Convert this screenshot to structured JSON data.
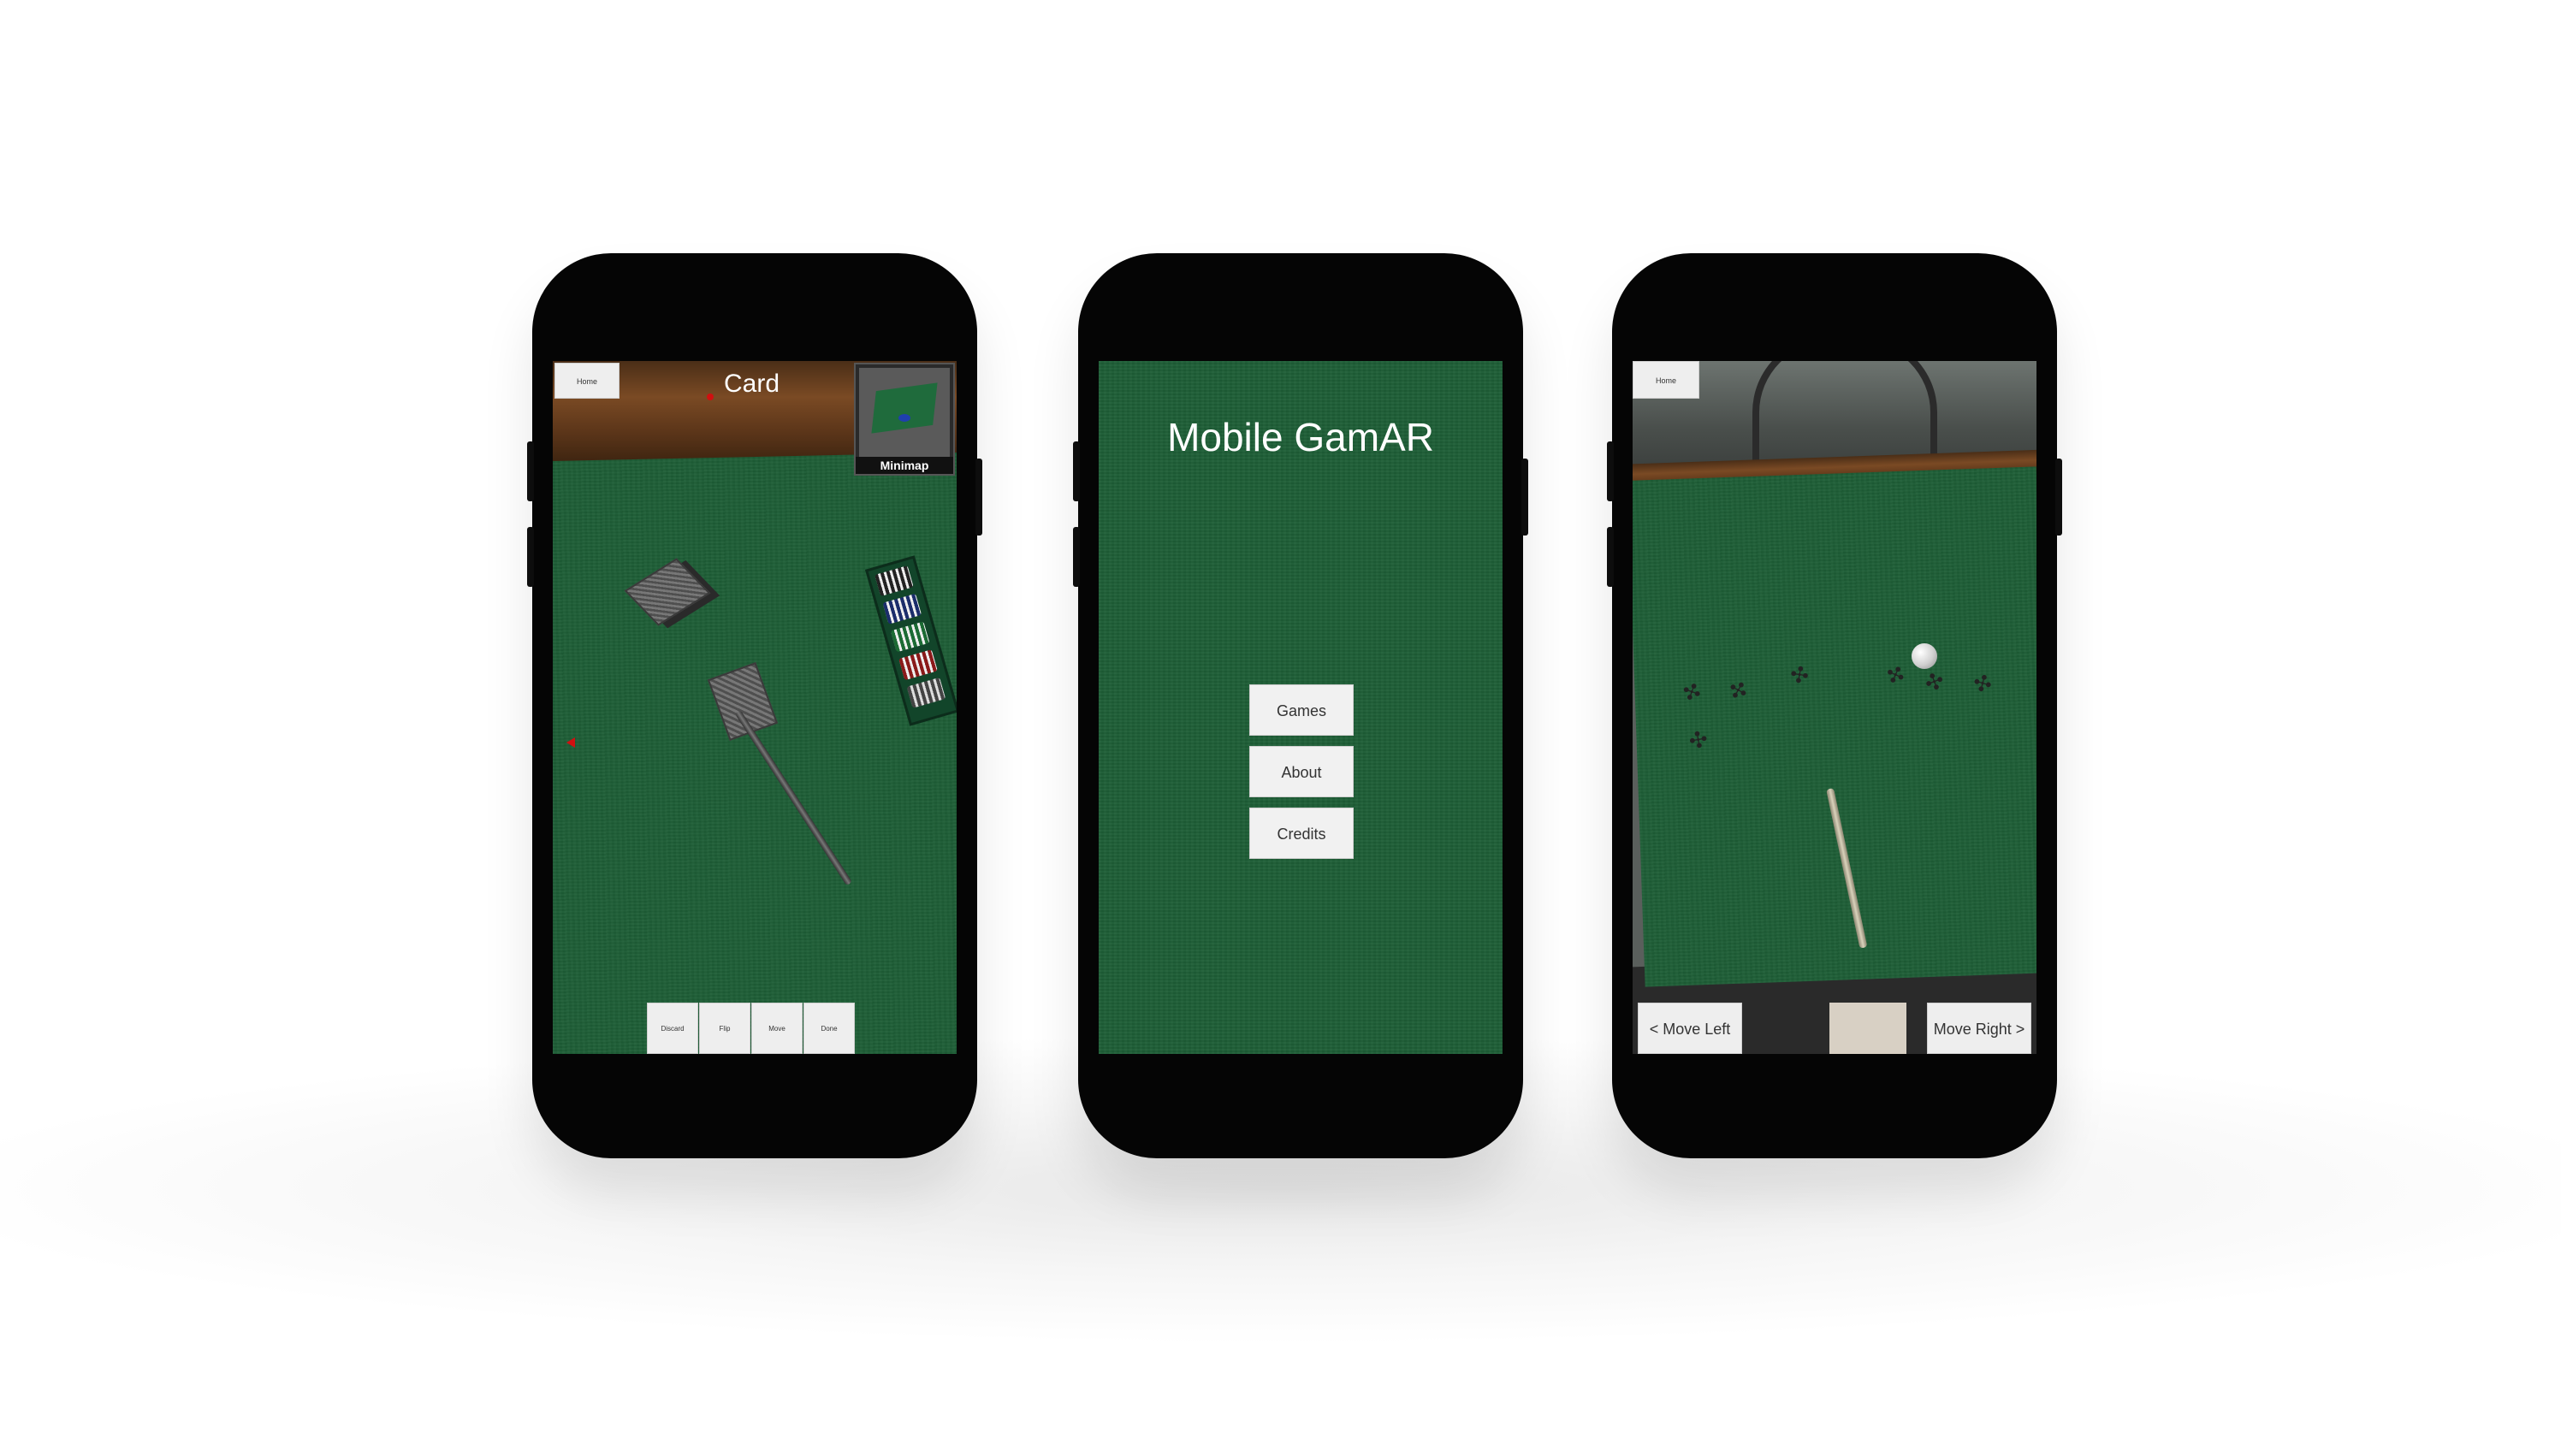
{
  "card_game_screen": {
    "home_label": "Home",
    "title": "Card",
    "minimap_label": "Minimap",
    "actions": [
      "Discard",
      "Flip",
      "Move",
      "Done"
    ]
  },
  "main_menu_screen": {
    "title": "Mobile GamAR",
    "buttons": [
      "Games",
      "About",
      "Credits"
    ]
  },
  "pool_game_screen": {
    "home_label": "Home",
    "move_left_label": "< Move Left",
    "move_right_label": "Move Right >"
  },
  "colors": {
    "felt": "#1f6339",
    "phone_body": "#050505",
    "button_bg": "#eeeeee",
    "marker_red": "#d01010"
  }
}
